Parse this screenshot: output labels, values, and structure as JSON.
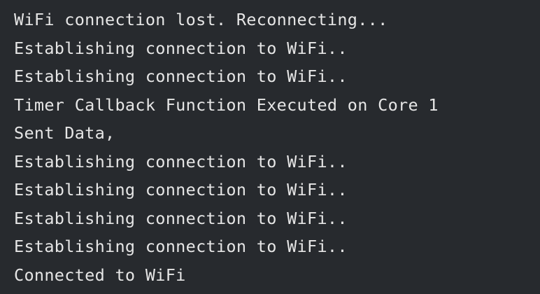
{
  "theme": {
    "background": "#272a2e",
    "text_color": "#e6e6e6"
  },
  "console": {
    "lines": [
      "WiFi connection lost. Reconnecting...",
      "Establishing connection to WiFi..",
      "Establishing connection to WiFi..",
      "Timer Callback Function Executed on Core 1",
      "Sent Data,",
      "Establishing connection to WiFi..",
      "Establishing connection to WiFi..",
      "Establishing connection to WiFi..",
      "Establishing connection to WiFi..",
      "Connected to WiFi"
    ]
  }
}
